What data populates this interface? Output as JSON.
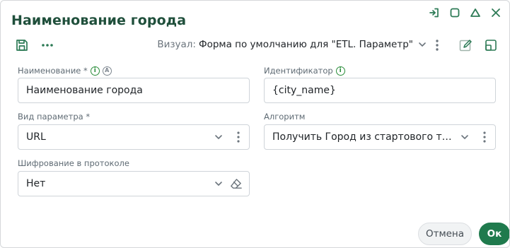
{
  "dialog": {
    "title": "Наименование города"
  },
  "toolbar": {
    "visual_label": "Визуал:",
    "visual_value": "Форма по умолчанию для \"ETL. Параметр\""
  },
  "fields": {
    "name": {
      "label": "Наименование *",
      "info": "i",
      "auto": "A",
      "value": "Наименование города"
    },
    "identifier": {
      "label": "Идентификатор",
      "info": "i",
      "value": "{city_name}"
    },
    "param_type": {
      "label": "Вид параметра *",
      "value": "URL"
    },
    "algorithm": {
      "label": "Алгоритм",
      "value": "Получить Город из стартового типа..."
    },
    "encryption": {
      "label": "Шифрование в протоколе",
      "value": "Нет"
    }
  },
  "footer": {
    "cancel_label": "Отмена",
    "ok_label": "Ок"
  },
  "colors": {
    "accent": "#1f7a4d",
    "title": "#1f4f3b",
    "icon": "#2c7a55",
    "info": "#2a8d3a"
  }
}
